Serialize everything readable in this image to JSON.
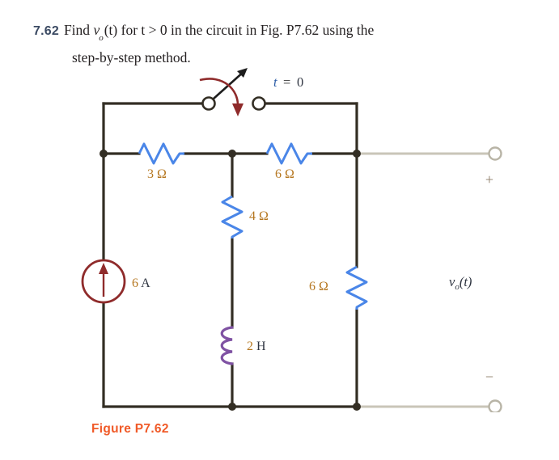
{
  "problem": {
    "number": "7.62",
    "line1_pre": "Find ",
    "line1_var": "v",
    "line1_sub": "o",
    "line1_mid": "(t) for t > 0 in the circuit in Fig. P7.62 using the",
    "line2": "step-by-step method."
  },
  "figure": {
    "caption": "Figure P7.62"
  },
  "circuit": {
    "switch": {
      "label_t": "t",
      "label_eq": "=",
      "label_zero": "0"
    },
    "source": {
      "value": "6",
      "unit": "A",
      "type": "current-source",
      "direction": "up"
    },
    "components": [
      {
        "id": "r3",
        "value": "3",
        "unit": "Ω",
        "type": "resistor",
        "orientation": "horizontal"
      },
      {
        "id": "r6a",
        "value": "6",
        "unit": "Ω",
        "type": "resistor",
        "orientation": "horizontal"
      },
      {
        "id": "r4",
        "value": "4",
        "unit": "Ω",
        "type": "resistor",
        "orientation": "vertical"
      },
      {
        "id": "r6b",
        "value": "6",
        "unit": "Ω",
        "type": "resistor",
        "orientation": "vertical"
      },
      {
        "id": "l2",
        "value": "2",
        "unit": "H",
        "type": "inductor",
        "orientation": "vertical"
      }
    ],
    "output": {
      "plus": "+",
      "minus": "−",
      "label_v": "v",
      "label_sub": "o",
      "label_arg": "(t)"
    },
    "colors": {
      "wire": "#332e24",
      "wire_light": "#c9c5b8",
      "resistor": "#4a86e8",
      "inductor": "#7f52a3",
      "source": "#8f2b2b",
      "switch_arc": "#8f2b2b",
      "caption": "#f05a28",
      "label_number": "#b5761f",
      "label_blue": "#2f5fa8"
    }
  }
}
